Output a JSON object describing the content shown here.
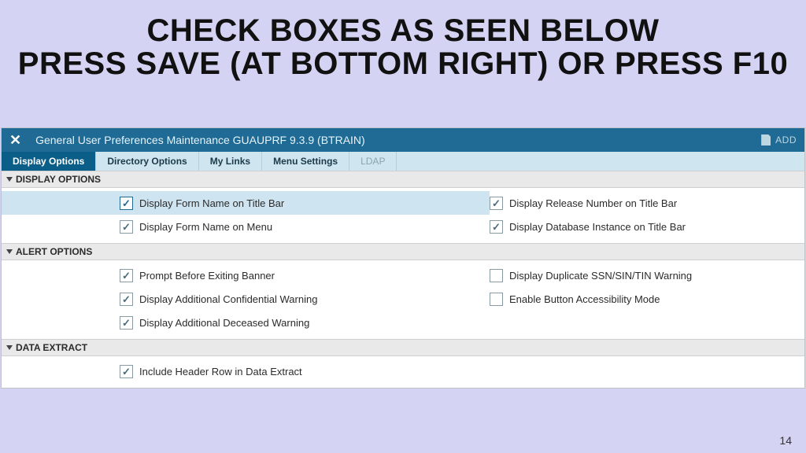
{
  "slide": {
    "line1": "CHECK BOXES AS SEEN BELOW",
    "line2": "PRESS SAVE (AT BOTTOM RIGHT) OR PRESS F10",
    "page": "14"
  },
  "titlebar": {
    "title": "General User Preferences Maintenance GUAUPRF 9.3.9 (BTRAIN)",
    "add_label": "ADD"
  },
  "tabs": {
    "t0": "Display Options",
    "t1": "Directory Options",
    "t2": "My Links",
    "t3": "Menu Settings",
    "t4": "LDAP"
  },
  "sections": {
    "display": {
      "header": "DISPLAY OPTIONS",
      "r0l": "Display Form Name on Title Bar",
      "r0r": "Display Release Number on Title Bar",
      "r1l": "Display Form Name on Menu",
      "r1r": "Display Database Instance on Title Bar"
    },
    "alert": {
      "header": "ALERT OPTIONS",
      "r0l": "Prompt Before Exiting Banner",
      "r0r": "Display Duplicate SSN/SIN/TIN Warning",
      "r1l": "Display Additional Confidential Warning",
      "r1r": "Enable Button Accessibility Mode",
      "r2l": "Display Additional Deceased Warning"
    },
    "data": {
      "header": "DATA EXTRACT",
      "r0l": "Include Header Row in Data Extract"
    }
  }
}
